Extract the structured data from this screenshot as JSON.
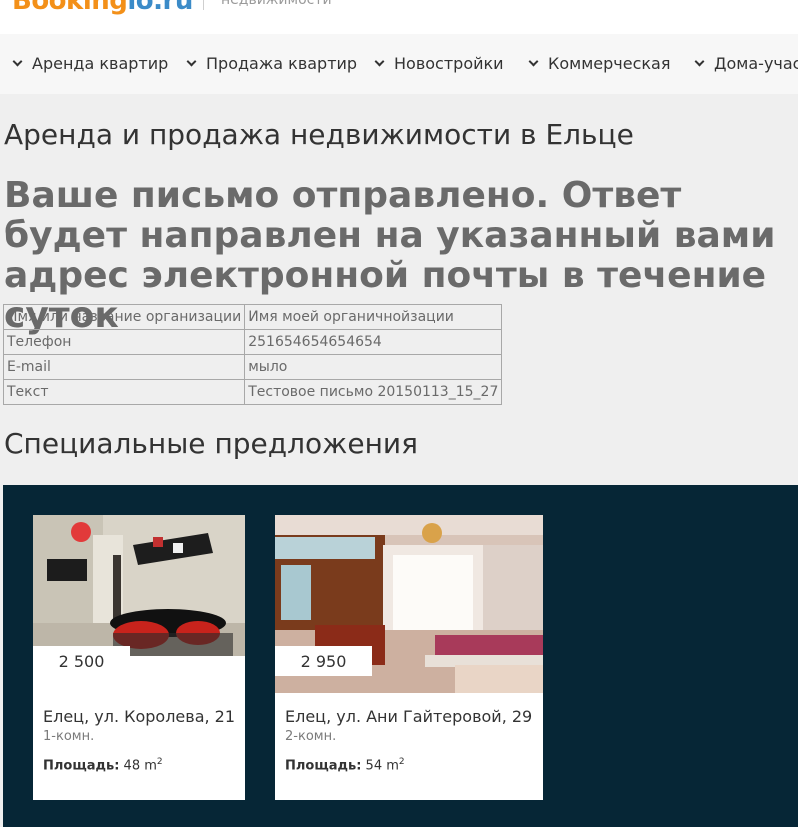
{
  "header": {
    "logo_main": "Booking",
    "logo_sub": "lo.ru",
    "tagline": "недвижимости"
  },
  "nav": {
    "items": [
      {
        "label": "Аренда квартир"
      },
      {
        "label": "Продажа квартир"
      },
      {
        "label": "Новостройки"
      },
      {
        "label": "Коммерческая"
      },
      {
        "label": "Дома-участ"
      }
    ]
  },
  "page": {
    "title": "Аренда и продажа недвижимости в Ельце",
    "message": "Ваше письмо отправлено. Ответ будет направлен на указанный вами адрес электронной почты в течение суток"
  },
  "form_data": {
    "rows": [
      {
        "key": "Имя или название организации",
        "value": "Имя моей органичнойзации"
      },
      {
        "key": "Телефон",
        "value": "251654654654654"
      },
      {
        "key": "E-mail",
        "value": "мыло"
      },
      {
        "key": "Текст",
        "value": "Тестовое письмо 20150113_15_27"
      }
    ]
  },
  "special": {
    "title": "Специальные предложения",
    "cards": [
      {
        "price": "2 500",
        "address": "Елец, ул. Королева, 21",
        "rooms": "1-комн.",
        "area_label": "Площадь:",
        "area_value": "48 m",
        "area_unit_sup": "2"
      },
      {
        "price": "2 950",
        "address": "Елец, ул. Ани Гайтеровой, 29",
        "rooms": "2-комн.",
        "area_label": "Площадь:",
        "area_value": "54 m",
        "area_unit_sup": "2"
      }
    ]
  },
  "colors": {
    "brand_orange": "#f39019",
    "brand_blue": "#3b8bc8",
    "offers_bg": "#062636",
    "message_text": "#6a6a6a"
  }
}
